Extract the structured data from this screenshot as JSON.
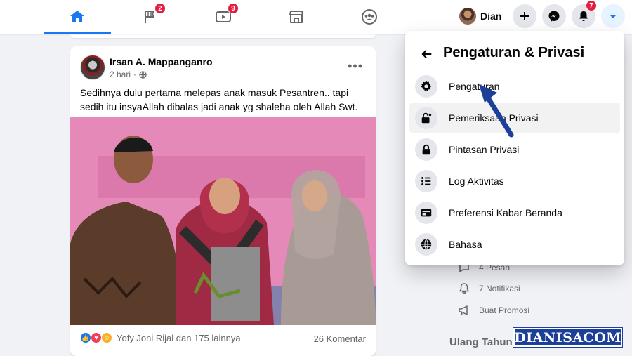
{
  "nav": {
    "tabs": [
      {
        "icon": "home-icon",
        "active": true
      },
      {
        "icon": "flag-icon",
        "badge": "2"
      },
      {
        "icon": "watch-icon",
        "badge": "9"
      },
      {
        "icon": "marketplace-icon"
      },
      {
        "icon": "groups-icon"
      }
    ],
    "profile_name": "Dian",
    "notification_badge": "7",
    "accent": "#1877f2"
  },
  "post": {
    "author": "Irsan A. Mappanganro",
    "time": "2 hari",
    "privacy_icon": "globe-icon",
    "text": "Sedihnya dulu pertama melepas anak masuk Pesantren.. tapi sedih itu insyaAllah dibalas jadi anak yg shaleha oleh Allah Swt.",
    "reactions": [
      "like",
      "love",
      "care"
    ],
    "reaction_text": "Yofy Joni Rijal dan 175 lainnya",
    "comments": "26 Komentar"
  },
  "dropdown": {
    "title": "Pengaturan & Privasi",
    "items": [
      {
        "label": "Pengaturan",
        "icon": "gear-icon"
      },
      {
        "label": "Pemeriksaan Privasi",
        "icon": "lock-check-icon"
      },
      {
        "label": "Pintasan Privasi",
        "icon": "lock-icon"
      },
      {
        "label": "Log Aktivitas",
        "icon": "list-icon"
      },
      {
        "label": "Preferensi Kabar Beranda",
        "icon": "feed-icon"
      },
      {
        "label": "Bahasa",
        "icon": "globe-icon"
      }
    ]
  },
  "sidebar": {
    "items": [
      {
        "label": "4 Pesan",
        "icon": "message-icon"
      },
      {
        "label": "7 Notifikasi",
        "icon": "bell-icon"
      },
      {
        "label": "Buat Promosi",
        "icon": "megaphone-icon"
      }
    ],
    "heading": "Ulang Tahun"
  },
  "watermark": "DIANISACOM"
}
